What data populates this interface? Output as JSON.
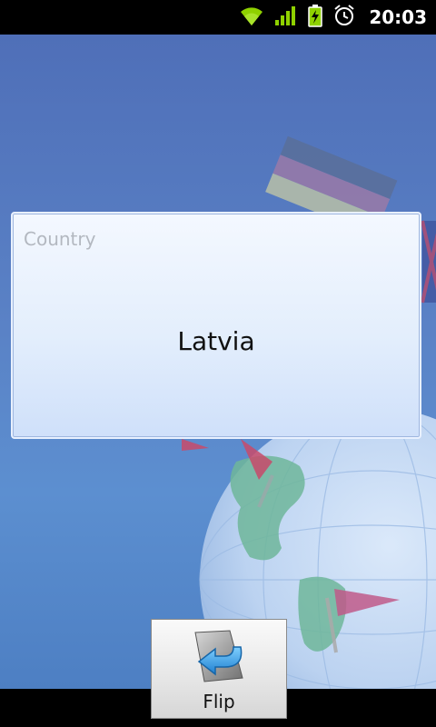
{
  "status_bar": {
    "time": "20:03",
    "icons": [
      "wifi-icon",
      "signal-icon",
      "battery-charging-icon",
      "alarm-icon"
    ],
    "icon_color": "#8fd100"
  },
  "card": {
    "label": "Country",
    "value": "Latvia"
  },
  "flip_button": {
    "label": "Flip",
    "icon": "flip-arrow-icon"
  },
  "colors": {
    "background": "#5a82c6",
    "card_fill": "#e3eefc",
    "label_text": "#b3b8c0"
  }
}
